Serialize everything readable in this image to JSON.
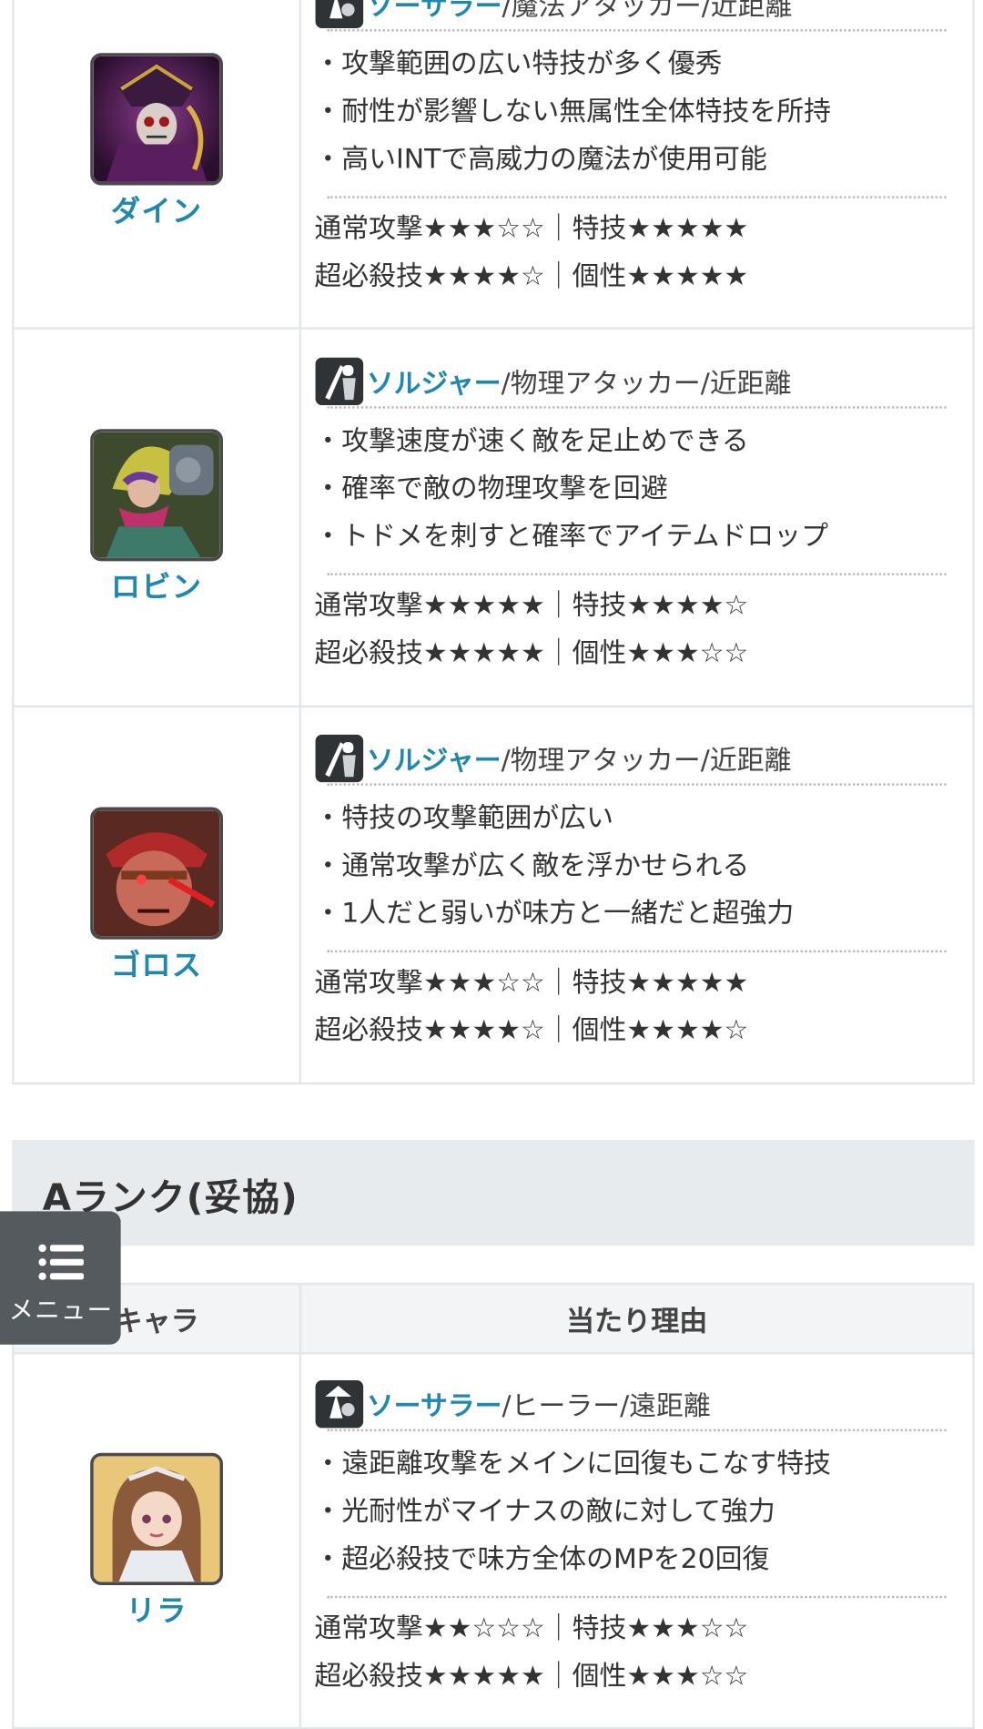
{
  "rows_s": [
    {
      "char": "ダイン",
      "role_link": "ソーサラー",
      "role_rest": "/魔法アタッカー/近距離",
      "points": [
        "・攻撃範囲の広い特技が多く優秀",
        "・耐性が影響しない無属性全体特技を所持",
        "・高いINTで高威力の魔法が使用可能"
      ],
      "rating1": "通常攻撃★★★☆☆｜特技★★★★★",
      "rating2": "超必殺技★★★★☆｜個性★★★★★"
    },
    {
      "char": "ロビン",
      "role_link": "ソルジャー",
      "role_rest": "/物理アタッカー/近距離",
      "points": [
        "・攻撃速度が速く敵を足止めできる",
        "・確率で敵の物理攻撃を回避",
        "・トドメを刺すと確率でアイテムドロップ"
      ],
      "rating1": "通常攻撃★★★★★｜特技★★★★☆",
      "rating2": "超必殺技★★★★★｜個性★★★☆☆"
    },
    {
      "char": "ゴロス",
      "role_link": "ソルジャー",
      "role_rest": "/物理アタッカー/近距離",
      "points": [
        "・特技の攻撃範囲が広い",
        "・通常攻撃が広く敵を浮かせられる",
        "・1人だと弱いが味方と一緒だと超強力"
      ],
      "rating1": "通常攻撃★★★☆☆｜特技★★★★★",
      "rating2": "超必殺技★★★★☆｜個性★★★★☆"
    }
  ],
  "rank_a_title": "Aランク(妥協)",
  "table_header": {
    "char": "キャラ",
    "reason": "当たり理由"
  },
  "rows_a": [
    {
      "char": "リラ",
      "role_link": "ソーサラー",
      "role_rest": "/ヒーラー/遠距離",
      "points": [
        "・遠距離攻撃をメインに回復もこなす特技",
        "・光耐性がマイナスの敵に対して強力",
        "・超必殺技で味方全体のMPを20回復"
      ],
      "rating1": "通常攻撃★★☆☆☆｜特技★★★☆☆",
      "rating2": "超必殺技★★★★★｜個性★★★☆☆"
    }
  ],
  "menu": {
    "label": "メニュー",
    "icon": "menu-list-icon"
  },
  "colors": {
    "link": "#1e88b0",
    "border": "#e3e6e8",
    "header_bg": "#e8ebed",
    "menu_bg": "#555a5e"
  }
}
